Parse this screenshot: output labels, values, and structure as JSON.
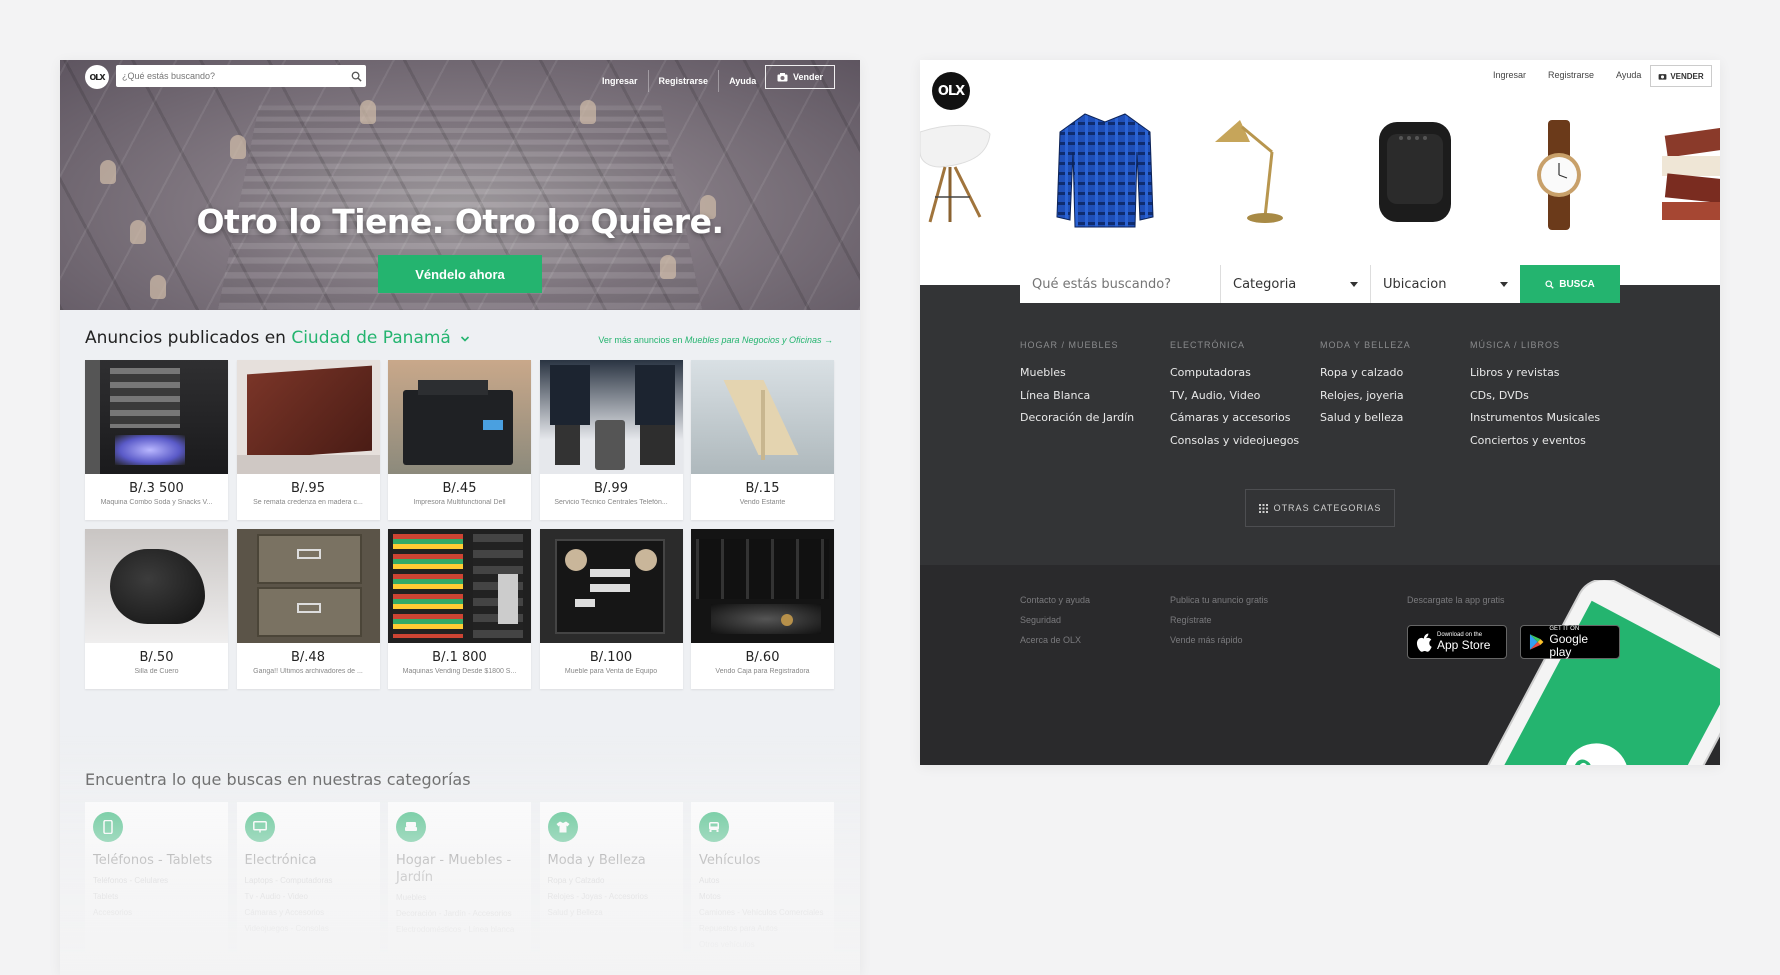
{
  "left": {
    "logo": "OLX",
    "search": {
      "placeholder": "¿Qué estás buscando?"
    },
    "nav": [
      "Ingresar",
      "Registrarse",
      "Ayuda"
    ],
    "sell_label": "Vender",
    "hero_title": "Otro lo Tiene. Otro lo Quiere.",
    "hero_cta": "Véndelo ahora",
    "ads_heading_prefix": "Anuncios publicados en",
    "ads_city": "Ciudad de Panamá",
    "ads_more_prefix": "Ver más anuncios en",
    "ads_more_link": "Muebles para Negocios y Oficinas →",
    "ads": [
      {
        "price": "B/.3 500",
        "desc": "Maquina Combo Soda y Snacks V..."
      },
      {
        "price": "B/.95",
        "desc": "Se remata credenza en madera c..."
      },
      {
        "price": "B/.45",
        "desc": "Impresora Multifunctional Dell"
      },
      {
        "price": "B/.99",
        "desc": "Servicio Técnico Centrales Telefón..."
      },
      {
        "price": "B/.15",
        "desc": "Vendo Estante"
      },
      {
        "price": "B/.50",
        "desc": "Silla de Cuero"
      },
      {
        "price": "B/.48",
        "desc": "Ganga!! Ultimos archivadores de ..."
      },
      {
        "price": "B/.1 800",
        "desc": "Maquinas Vending Desde $1800 S..."
      },
      {
        "price": "B/.100",
        "desc": "Mueble para Venta de Equipo"
      },
      {
        "price": "B/.60",
        "desc": "Vendo Caja para Registradora"
      }
    ],
    "categories_heading": "Encuentra lo que buscas en nuestras categorías",
    "categories": [
      {
        "name": "Teléfonos - Tablets",
        "icon": "phone-icon",
        "subs": [
          "Teléfonos - Celulares",
          "Tablets",
          "Accesorios"
        ]
      },
      {
        "name": "Electrónica",
        "icon": "monitor-icon",
        "subs": [
          "Laptops - Computadoras",
          "Tv - Audio - Video",
          "Cámaras y Accesorios",
          "Videojuegos - Consolas"
        ]
      },
      {
        "name": "Hogar - Muebles - Jardín",
        "icon": "sofa-icon",
        "subs": [
          "Muebles",
          "Decoración - Jardín - Accesorios",
          "Electrodomésticos - Línea blanca"
        ]
      },
      {
        "name": "Moda y Belleza",
        "icon": "shirt-icon",
        "subs": [
          "Ropa y Calzado",
          "Relojes - Joyas - Accesorios",
          "Salud y Belleza"
        ]
      },
      {
        "name": "Vehículos",
        "icon": "car-icon",
        "subs": [
          "Autos",
          "Motos",
          "Camiones - Vehículos Comerciales",
          "Repuestos para Autos",
          "Otros vehículos"
        ]
      }
    ]
  },
  "right": {
    "logo": "OLX",
    "nav": [
      "Ingresar",
      "Registrarse",
      "Ayuda"
    ],
    "sell_label": "VENDER",
    "search": {
      "placeholder": "Qué estás buscando?",
      "category": "Categoria",
      "location": "Ubicacion",
      "button": "BUSCA"
    },
    "columns": [
      {
        "heading": "HOGAR / MUEBLES",
        "items": [
          "Muebles",
          "Línea Blanca",
          "Decoración de Jardín"
        ]
      },
      {
        "heading": "ELECTRÓNICA",
        "items": [
          "Computadoras",
          "TV, Audio, Video",
          "Cámaras y accesorios",
          "Consolas y videojuegos"
        ]
      },
      {
        "heading": "MODA Y BELLEZA",
        "items": [
          "Ropa y calzado",
          "Relojes, joyeria",
          "Salud y belleza"
        ]
      },
      {
        "heading": "MÚSICA / LIBROS",
        "items": [
          "Libros y revistas",
          "CDs, DVDs",
          "Instrumentos Musicales",
          "Conciertos y eventos"
        ]
      }
    ],
    "other_categories": "OTRAS CATEGORIAS",
    "footer": {
      "col1": [
        "Contacto y ayuda",
        "Seguridad",
        "Acerca de OLX"
      ],
      "col2": [
        "Publica tu anuncio gratis",
        "Regístrate",
        "Vende más rápido"
      ],
      "app_heading": "Descargate la app gratis",
      "appstore_small": "Download on the",
      "appstore_big": "App Store",
      "googleplay_small": "GET IT ON",
      "googleplay_big": "Google play",
      "phone_logo": "OLX"
    }
  },
  "colors": {
    "accent": "#24b46f",
    "dark": "#333436",
    "footer": "#2a2a2c"
  }
}
